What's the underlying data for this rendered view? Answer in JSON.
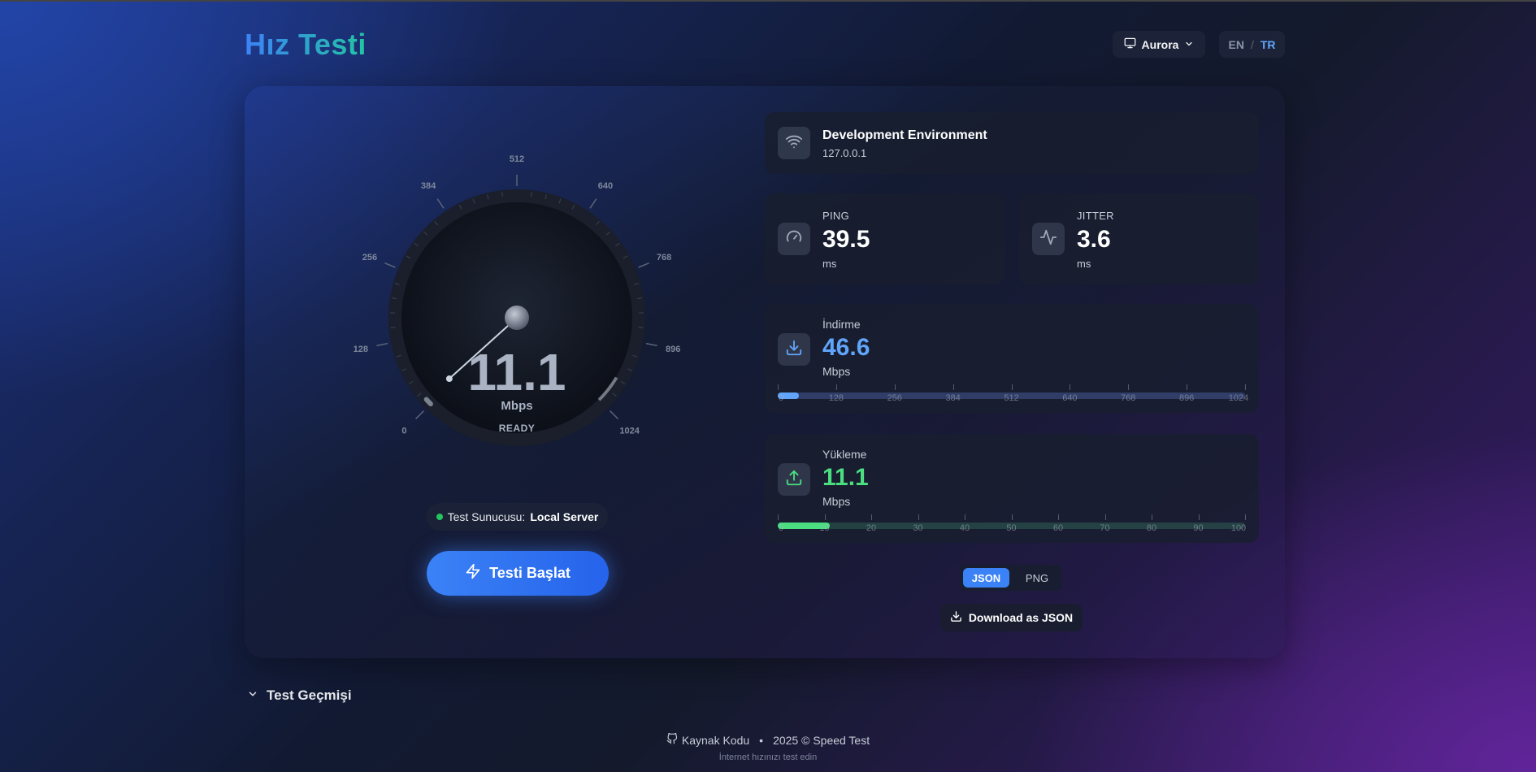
{
  "header": {
    "logo": "Hız Testi",
    "theme": {
      "label": "Aurora",
      "icon": "monitor-icon"
    },
    "languages": {
      "en": "EN",
      "separator": "/",
      "tr": "TR",
      "active": "TR"
    }
  },
  "gauge": {
    "value": "11.1",
    "value_number": 11.1,
    "unit": "Mbps",
    "status": "READY",
    "max": 1024,
    "ticks": [
      "0",
      "128",
      "256",
      "384",
      "512",
      "640",
      "768",
      "896",
      "1024"
    ]
  },
  "server": {
    "label": "Test Sunucusu:",
    "value": "Local Server"
  },
  "start_button": {
    "label": "Testi Başlat",
    "icon": "bolt-icon"
  },
  "environment": {
    "title": "Development Environment",
    "ip": "127.0.0.1",
    "icon": "wifi-icon"
  },
  "ping": {
    "label": "PING",
    "value": "39.5",
    "unit": "ms",
    "icon": "speedometer-icon"
  },
  "jitter": {
    "label": "JITTER",
    "value": "3.6",
    "unit": "ms",
    "icon": "activity-icon"
  },
  "download": {
    "label": "İndirme",
    "value": "46.6",
    "unit": "Mbps",
    "icon": "download-icon",
    "color": "#60a5fa",
    "fill_value": 46.6,
    "scale_max": 1024,
    "ticks": [
      "0",
      "128",
      "256",
      "384",
      "512",
      "640",
      "768",
      "896",
      "1024"
    ]
  },
  "upload": {
    "label": "Yükleme",
    "value": "11.1",
    "unit": "Mbps",
    "icon": "upload-icon",
    "color": "#4ade80",
    "fill_value": 11.1,
    "scale_max": 100,
    "ticks": [
      "0",
      "10",
      "20",
      "30",
      "40",
      "50",
      "60",
      "70",
      "80",
      "90",
      "100"
    ]
  },
  "export": {
    "json_label": "JSON",
    "png_label": "PNG",
    "selected": "JSON",
    "download_label": "Download as JSON"
  },
  "history": {
    "label": "Test Geçmişi"
  },
  "footer": {
    "source": "Kaynak Kodu",
    "separator": "•",
    "copyright": "2025 © Speed Test",
    "tagline": "İnternet hızınızı test edin"
  }
}
